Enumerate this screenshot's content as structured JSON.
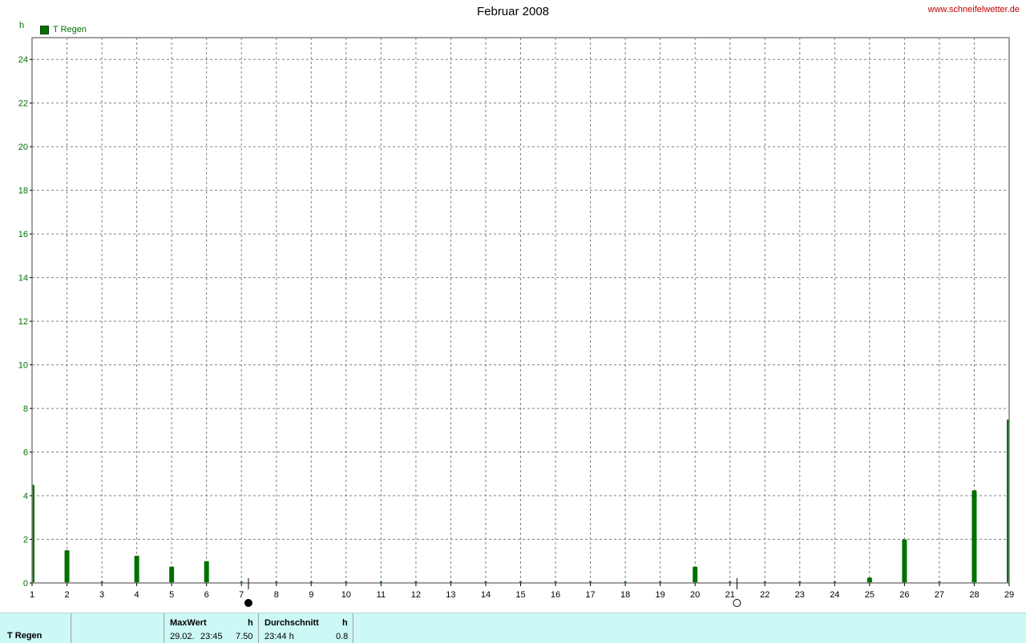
{
  "header": {
    "title": "Februar 2008",
    "site": "www.schneifelwetter.de",
    "unit": "h",
    "legend_label": "T Regen"
  },
  "colors": {
    "series": "#007000",
    "axis_text": "#007000",
    "grid": "#808080",
    "footer_bg": "#ccf8f5",
    "site_text": "#c00000"
  },
  "chart_data": {
    "type": "bar",
    "title": "Februar 2008",
    "ylabel": "h",
    "xlabel": "",
    "xlim": [
      1,
      29
    ],
    "ylim": [
      0,
      25
    ],
    "y_ticks": [
      0,
      2,
      4,
      6,
      8,
      10,
      12,
      14,
      16,
      18,
      20,
      22,
      24
    ],
    "x_ticks": [
      1,
      2,
      3,
      4,
      5,
      6,
      7,
      8,
      9,
      10,
      11,
      12,
      13,
      14,
      15,
      16,
      17,
      18,
      19,
      20,
      21,
      22,
      23,
      24,
      25,
      26,
      27,
      28,
      29
    ],
    "grid": true,
    "legend": "top-left",
    "moon_phases": [
      {
        "day": 7.2,
        "phase": "new-moon"
      },
      {
        "day": 21.2,
        "phase": "full-moon"
      }
    ],
    "series": [
      {
        "name": "T Regen",
        "points": [
          {
            "x": 1,
            "y": 4.5
          },
          {
            "x": 2,
            "y": 1.5
          },
          {
            "x": 3,
            "y": 0
          },
          {
            "x": 4,
            "y": 1.25
          },
          {
            "x": 5,
            "y": 0.75
          },
          {
            "x": 6,
            "y": 1.0
          },
          {
            "x": 7,
            "y": 0
          },
          {
            "x": 8,
            "y": 0
          },
          {
            "x": 9,
            "y": 0
          },
          {
            "x": 10,
            "y": 0
          },
          {
            "x": 11,
            "y": 0
          },
          {
            "x": 12,
            "y": 0
          },
          {
            "x": 13,
            "y": 0
          },
          {
            "x": 14,
            "y": 0
          },
          {
            "x": 15,
            "y": 0
          },
          {
            "x": 16,
            "y": 0
          },
          {
            "x": 17,
            "y": 0
          },
          {
            "x": 18,
            "y": 0
          },
          {
            "x": 19,
            "y": 0
          },
          {
            "x": 20,
            "y": 0.75
          },
          {
            "x": 21,
            "y": 0
          },
          {
            "x": 22,
            "y": 0
          },
          {
            "x": 23,
            "y": 0
          },
          {
            "x": 24,
            "y": 0
          },
          {
            "x": 25,
            "y": 0.25
          },
          {
            "x": 26,
            "y": 2.0
          },
          {
            "x": 27,
            "y": 0
          },
          {
            "x": 28,
            "y": 4.25
          },
          {
            "x": 29,
            "y": 7.5
          }
        ]
      }
    ]
  },
  "footer": {
    "series_name": "T Regen",
    "max_header": "MaxWert",
    "max_unit": "h",
    "max_date": "29.02.",
    "max_time": "23:45",
    "max_value": "7.50",
    "avg_header": "Durchschnitt",
    "avg_unit": "h",
    "avg_time": "23:44 h",
    "avg_value": "0.8"
  }
}
